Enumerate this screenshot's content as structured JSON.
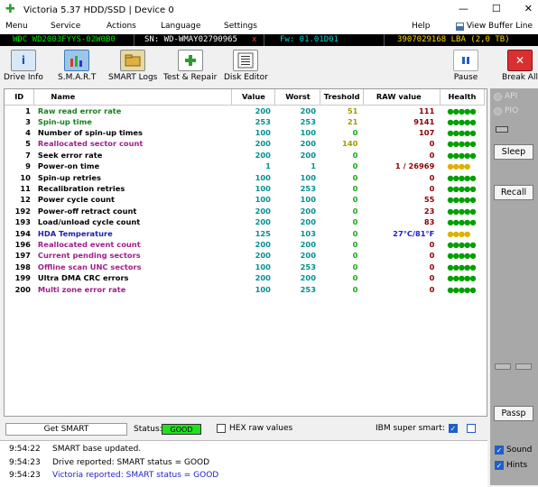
{
  "titlebar": {
    "title": "Victoria 5.37 HDD/SSD | Device 0",
    "minimize": "—",
    "maximize": "☐",
    "close": "✕"
  },
  "menu": {
    "items": [
      "Menu",
      "Service",
      "Actions",
      "Language",
      "Settings",
      "Help"
    ],
    "view_buffer": "View Buffer Line"
  },
  "drive": {
    "model": "WDC WD2003FYYS-02W0B0",
    "serial": "SN: WD-WMAY02790965",
    "close": "x",
    "firmware": "Fw: 01.01D01",
    "lba": "3907029168 LBA (2,0 TB)"
  },
  "toolbar": {
    "drive_info": "Drive Info",
    "smart": "S.M.A.R.T",
    "smart_logs": "SMART Logs",
    "test_repair": "Test & Repair",
    "disk_editor": "Disk Editor",
    "pause": "Pause",
    "break_all": "Break All"
  },
  "smart_table": {
    "headers": {
      "id": "ID",
      "name": "Name",
      "value": "Value",
      "worst": "Worst",
      "threshold": "Treshold",
      "raw": "RAW value",
      "health": "Health"
    },
    "rows": [
      {
        "id": "1",
        "name": "Raw read error rate",
        "value": "200",
        "worst": "200",
        "threshold": "51",
        "raw": "111",
        "health": "●●●●●",
        "name_color": "green",
        "thr_color": "olive",
        "health_color": "green"
      },
      {
        "id": "3",
        "name": "Spin-up time",
        "value": "253",
        "worst": "253",
        "threshold": "21",
        "raw": "9141",
        "health": "●●●●●",
        "name_color": "green",
        "thr_color": "olive",
        "health_color": "green"
      },
      {
        "id": "4",
        "name": "Number of spin-up times",
        "value": "100",
        "worst": "100",
        "threshold": "0",
        "raw": "107",
        "health": "●●●●●",
        "name_color": "black",
        "thr_color": "green",
        "health_color": "green"
      },
      {
        "id": "5",
        "name": "Reallocated sector count",
        "value": "200",
        "worst": "200",
        "threshold": "140",
        "raw": "0",
        "health": "●●●●●",
        "name_color": "magenta",
        "thr_color": "olive",
        "health_color": "green"
      },
      {
        "id": "7",
        "name": "Seek error rate",
        "value": "200",
        "worst": "200",
        "threshold": "0",
        "raw": "0",
        "health": "●●●●●",
        "name_color": "black",
        "thr_color": "green",
        "health_color": "green"
      },
      {
        "id": "9",
        "name": "Power-on time",
        "value": "1",
        "worst": "1",
        "threshold": "0",
        "raw": "1 / 26969",
        "health": "●●●●",
        "name_color": "black",
        "thr_color": "green",
        "health_color": "yellow"
      },
      {
        "id": "10",
        "name": "Spin-up retries",
        "value": "100",
        "worst": "100",
        "threshold": "0",
        "raw": "0",
        "health": "●●●●●",
        "name_color": "black",
        "thr_color": "green",
        "health_color": "green"
      },
      {
        "id": "11",
        "name": "Recalibration retries",
        "value": "100",
        "worst": "253",
        "threshold": "0",
        "raw": "0",
        "health": "●●●●●",
        "name_color": "black",
        "thr_color": "green",
        "health_color": "green"
      },
      {
        "id": "12",
        "name": "Power cycle count",
        "value": "100",
        "worst": "100",
        "threshold": "0",
        "raw": "55",
        "health": "●●●●●",
        "name_color": "black",
        "thr_color": "green",
        "health_color": "green"
      },
      {
        "id": "192",
        "name": "Power-off retract count",
        "value": "200",
        "worst": "200",
        "threshold": "0",
        "raw": "23",
        "health": "●●●●●",
        "name_color": "black",
        "thr_color": "green",
        "health_color": "green"
      },
      {
        "id": "193",
        "name": "Load/unload cycle count",
        "value": "200",
        "worst": "200",
        "threshold": "0",
        "raw": "83",
        "health": "●●●●●",
        "name_color": "black",
        "thr_color": "green",
        "health_color": "green"
      },
      {
        "id": "194",
        "name": "HDA Temperature",
        "value": "125",
        "worst": "103",
        "threshold": "0",
        "raw": "27°C/81°F",
        "health": "●●●●",
        "name_color": "blue",
        "thr_color": "green",
        "health_color": "yellow",
        "raw_color": "blue"
      },
      {
        "id": "196",
        "name": "Reallocated event count",
        "value": "200",
        "worst": "200",
        "threshold": "0",
        "raw": "0",
        "health": "●●●●●",
        "name_color": "magenta",
        "thr_color": "green",
        "health_color": "green"
      },
      {
        "id": "197",
        "name": "Current pending sectors",
        "value": "200",
        "worst": "200",
        "threshold": "0",
        "raw": "0",
        "health": "●●●●●",
        "name_color": "magenta",
        "thr_color": "green",
        "health_color": "green"
      },
      {
        "id": "198",
        "name": "Offline scan UNC sectors",
        "value": "100",
        "worst": "253",
        "threshold": "0",
        "raw": "0",
        "health": "●●●●●",
        "name_color": "magenta",
        "thr_color": "green",
        "health_color": "green"
      },
      {
        "id": "199",
        "name": "Ultra DMA CRC errors",
        "value": "200",
        "worst": "200",
        "threshold": "0",
        "raw": "0",
        "health": "●●●●●",
        "name_color": "black",
        "thr_color": "green",
        "health_color": "green"
      },
      {
        "id": "200",
        "name": "Multi zone error rate",
        "value": "100",
        "worst": "253",
        "threshold": "0",
        "raw": "0",
        "health": "●●●●●",
        "name_color": "magenta",
        "thr_color": "green",
        "health_color": "green"
      }
    ]
  },
  "right_panel": {
    "api": "API",
    "pio": "PIO",
    "sleep": "Sleep",
    "recall": "Recall",
    "passp": "Passp",
    "sound": "Sound",
    "hints": "Hints"
  },
  "status_row": {
    "get_smart": "Get SMART",
    "status_label": "Status:",
    "status_value": "GOOD",
    "hex_label": "HEX raw values",
    "ibm_label": "IBM super smart:"
  },
  "log": [
    {
      "time": "9:54:22",
      "text": "SMART base updated.",
      "color": "black"
    },
    {
      "time": "9:54:23",
      "text": "Drive reported: SMART status = GOOD",
      "color": "black"
    },
    {
      "time": "9:54:23",
      "text": "Victoria reported: SMART status = GOOD",
      "color": "blue"
    }
  ],
  "colors": {
    "status_good": "#20e020",
    "drive_bar": "#000000",
    "right_panel": "#a8a8a8"
  }
}
